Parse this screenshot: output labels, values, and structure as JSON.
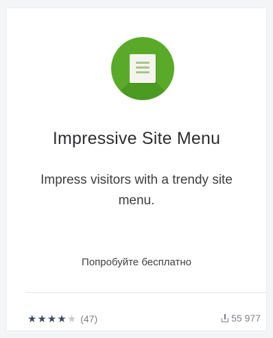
{
  "app": {
    "title": "Impressive Site Menu",
    "description": "Impress visitors with a trendy site menu.",
    "icon": "document-menu-icon",
    "icon_color": "#5aaa2a"
  },
  "actions": {
    "try_label": "Попробуйте бесплатно"
  },
  "footer": {
    "rating": 4,
    "rating_max": 5,
    "reviews_count": "(47)",
    "installs": "55 977"
  }
}
